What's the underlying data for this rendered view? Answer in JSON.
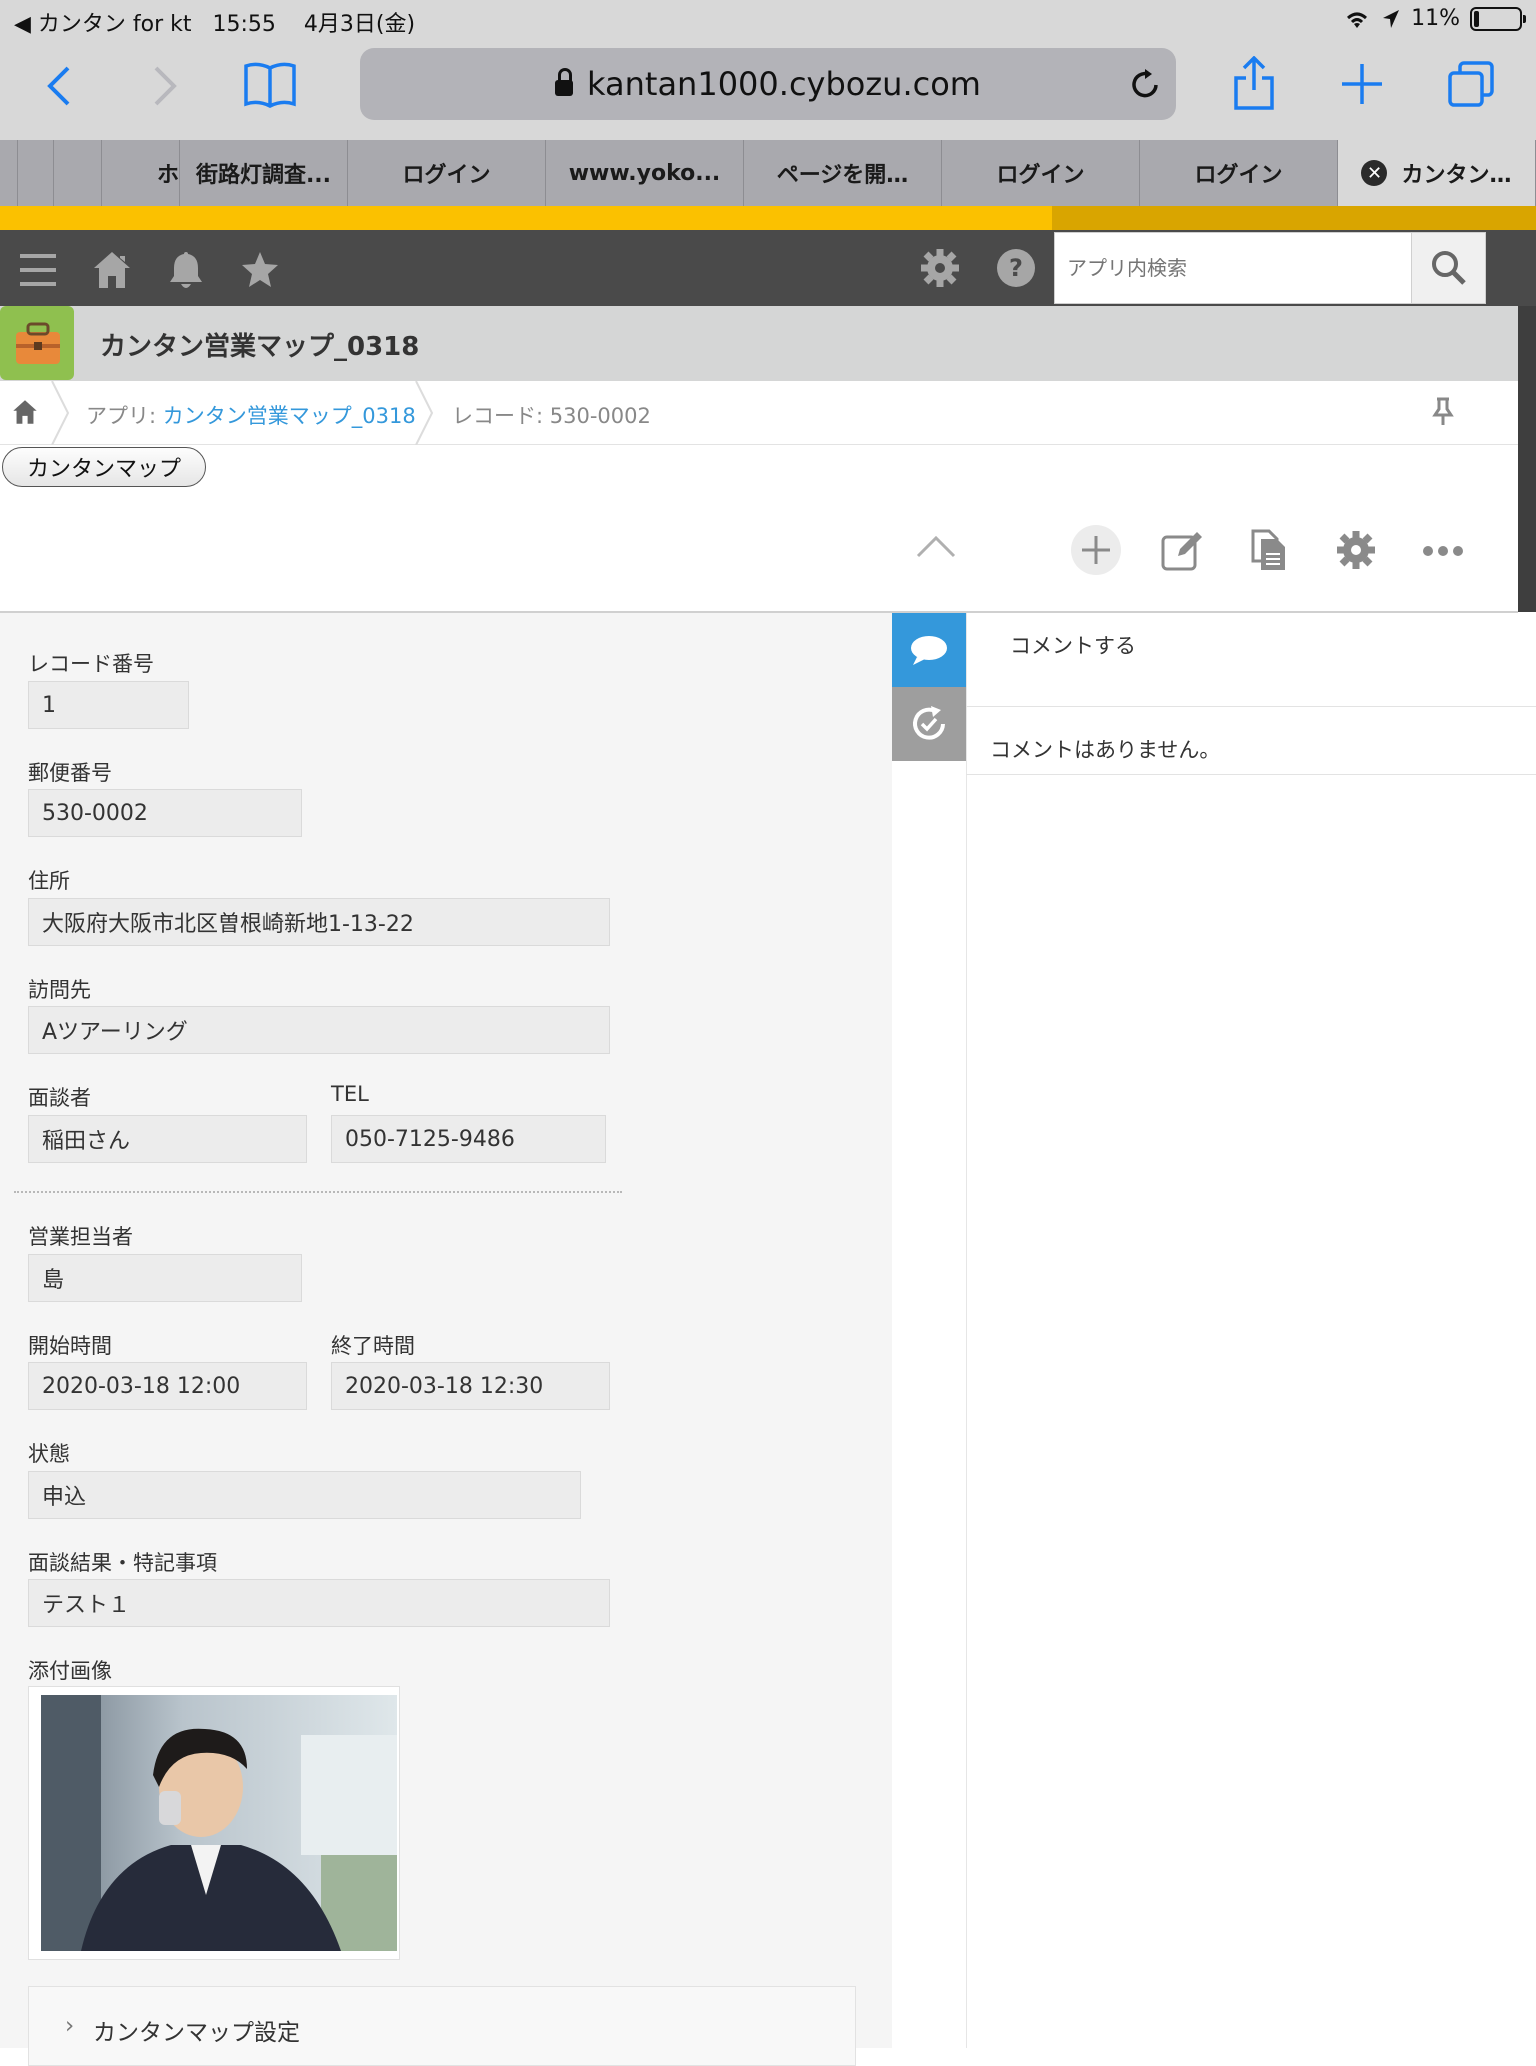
{
  "status_bar": {
    "back_app": "◀ カンタン for kt",
    "time": "15:55",
    "date": "4月3日(金)",
    "battery": "11%"
  },
  "browser": {
    "url": "kantan1000.cybozu.com",
    "tabs": [
      {
        "label": ""
      },
      {
        "label": ""
      },
      {
        "label": "ホ"
      },
      {
        "label": "街路灯調査..."
      },
      {
        "label": "ログイン"
      },
      {
        "label": "www.yoko..."
      },
      {
        "label": "ページを開…"
      },
      {
        "label": "ログイン"
      },
      {
        "label": "ログイン"
      },
      {
        "label": "カンタン…",
        "active": true
      }
    ]
  },
  "header": {
    "search_placeholder": "アプリ内検索"
  },
  "app": {
    "title": "カンタン営業マップ_0318"
  },
  "breadcrumb": {
    "app_prefix": "アプリ: ",
    "app_name": "カンタン営業マップ_0318",
    "record": "レコード: 530-0002"
  },
  "custom_button": "カンタンマップ",
  "record": {
    "record_no": {
      "label": "レコード番号",
      "value": "1"
    },
    "postal": {
      "label": "郵便番号",
      "value": "530-0002"
    },
    "address": {
      "label": "住所",
      "value": "大阪府大阪市北区曽根崎新地1-13-22"
    },
    "visit": {
      "label": "訪問先",
      "value": "Aツアーリング"
    },
    "contact": {
      "label": "面談者",
      "value": "稲田さん"
    },
    "tel": {
      "label": "TEL",
      "value": "050-7125-9486"
    },
    "sales_rep": {
      "label": "営業担当者",
      "value": "島"
    },
    "start": {
      "label": "開始時間",
      "value": "2020-03-18 12:00"
    },
    "end": {
      "label": "終了時間",
      "value": "2020-03-18 12:30"
    },
    "status": {
      "label": "状態",
      "value": "申込"
    },
    "result": {
      "label": "面談結果・特記事項",
      "value": "テスト１"
    },
    "attachment": {
      "label": "添付画像"
    },
    "group": {
      "label": "カンタンマップ設定"
    }
  },
  "comments": {
    "input_placeholder": "コメントする",
    "empty": "コメントはありません。"
  },
  "colors": {
    "yellow_bar": "#fbc100",
    "header_bg": "#4a4a4a",
    "link": "#3498db",
    "app_icon": "#8fc04f",
    "comment_tab_active": "#3498db"
  }
}
